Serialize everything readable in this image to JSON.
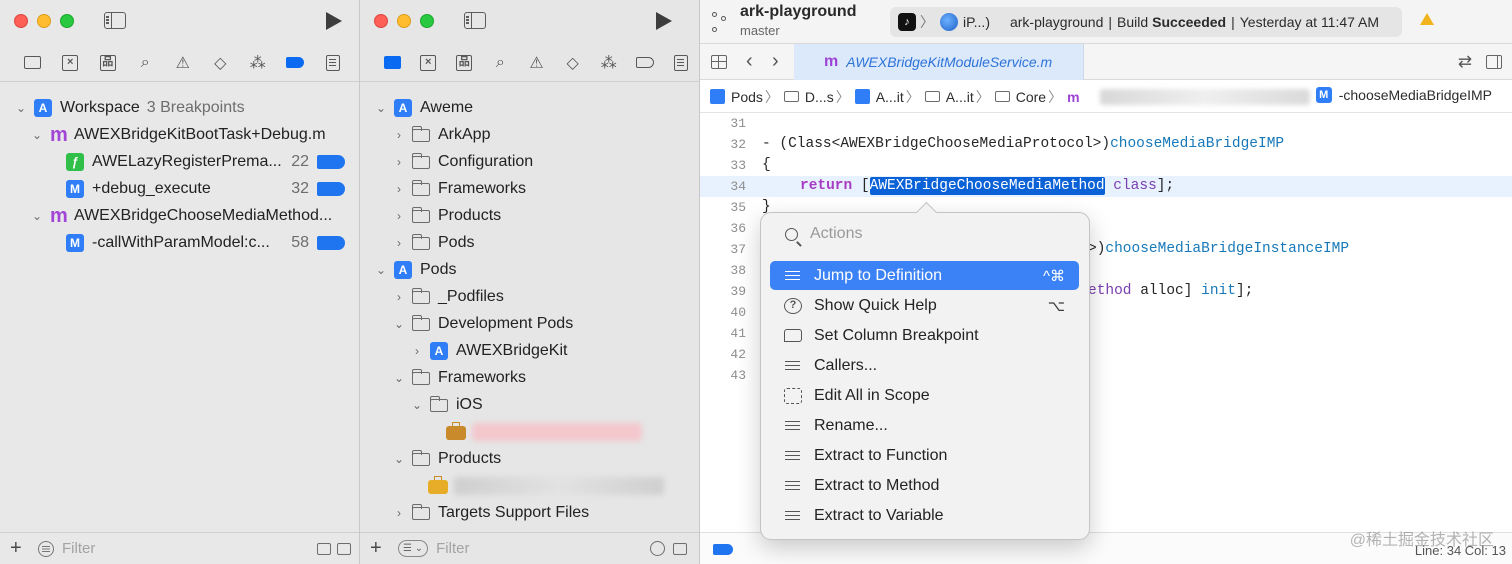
{
  "left_window": {
    "root": {
      "label": "Workspace",
      "sub": "3 Breakpoints"
    },
    "rows": [
      {
        "type": "mfile",
        "label": "AWEXBridgeKitBootTask+Debug.m"
      },
      {
        "type": "swift",
        "icon": "ƒ",
        "label": "AWELazyRegisterPrema...",
        "count": "22"
      },
      {
        "type": "method",
        "icon": "M",
        "label": "+debug_execute",
        "count": "32"
      },
      {
        "type": "mfile",
        "label": "AWEXBridgeChooseMediaMethod..."
      },
      {
        "type": "method",
        "icon": "M",
        "label": "-callWithParamModel:c...",
        "count": "58"
      }
    ],
    "filter_placeholder": "Filter",
    "add_label": "+"
  },
  "mid_window": {
    "rows": [
      {
        "label": "Aweme",
        "kind": "project",
        "icon": "A"
      },
      {
        "label": "ArkApp",
        "kind": "folder"
      },
      {
        "label": "Configuration",
        "kind": "folder"
      },
      {
        "label": "Frameworks",
        "kind": "folder"
      },
      {
        "label": "Products",
        "kind": "folder"
      },
      {
        "label": "Pods",
        "kind": "folder"
      },
      {
        "label": "Pods",
        "kind": "project",
        "icon": "A"
      },
      {
        "label": "_Podfiles",
        "kind": "folder"
      },
      {
        "label": "Development Pods",
        "kind": "folder"
      },
      {
        "label": "AWEXBridgeKit",
        "kind": "project",
        "icon": "A"
      },
      {
        "label": "Frameworks",
        "kind": "folder"
      },
      {
        "label": "iOS",
        "kind": "folder"
      },
      {
        "label": "Products",
        "kind": "folder"
      },
      {
        "label": "Targets Support Files",
        "kind": "folder"
      }
    ],
    "filter_placeholder": "Filter",
    "add_label": "+"
  },
  "editor": {
    "project_name": "ark-playground",
    "branch": "master",
    "status": {
      "app_icon": "♪",
      "device": "iP...)",
      "project": "ark-playground",
      "sep1": "|",
      "build_prefix": "Build",
      "build_state": "Succeeded",
      "sep2": "|",
      "time": "Yesterday at 11:47 AM"
    },
    "tab_icon": "m",
    "tab_file": "AWEXBridgeKitModuleService.m",
    "jumpbar": [
      "Pods",
      "D...s",
      "A...it",
      "A...it",
      "Core"
    ],
    "jumpbar_file_icon": "m",
    "jumpbar_method_icon": "M",
    "jumpbar_method": "-chooseMediaBridgeIMP",
    "lines": {
      "l31": "31",
      "l32": "32",
      "l33": "33",
      "l34": "34",
      "l35": "35",
      "l36": "36",
      "l37": "37",
      "l38": "38",
      "l39": "39",
      "l40": "40",
      "l41": "41",
      "l42": "42",
      "l43": "43"
    },
    "code": {
      "c32_a": "- (Class<AWEXBridgeChooseMediaProtocol>)",
      "c32_b": "chooseMediaBridgeIMP",
      "c33": "{",
      "c34_kw": "return",
      "c34_open": " [",
      "c34_sel": "AWEXBridgeChooseMediaMethod",
      "c34_cls": "class",
      "c34_end": "];",
      "c35": "}",
      "c37_a": ">)",
      "c37_b": "chooseMediaBridgeInstanceIMP",
      "c39_a": "ethod",
      "c39_b": " alloc] ",
      "c39_c": "init",
      "c39_d": "];"
    },
    "line_col": "Line: 34  Col: 13",
    "watermark": "@稀土掘金技术社区"
  },
  "context_menu": {
    "search_placeholder": "Actions",
    "items": [
      {
        "label": "Jump to Definition",
        "shortcut": "^⌘",
        "selected": true
      },
      {
        "label": "Show Quick Help",
        "shortcut": "⌥",
        "icon_glyph": "?"
      },
      {
        "label": "Set Column Breakpoint",
        "shortcut": ""
      },
      {
        "label": "Callers...",
        "shortcut": ""
      },
      {
        "label": "Edit All in Scope",
        "shortcut": ""
      },
      {
        "label": "Rename...",
        "shortcut": ""
      },
      {
        "label": "Extract to Function",
        "shortcut": ""
      },
      {
        "label": "Extract to Method",
        "shortcut": ""
      },
      {
        "label": "Extract to Variable",
        "shortcut": ""
      }
    ]
  },
  "colors": {
    "accent": "#0b6af2",
    "selection": "#3b82f6",
    "keyword": "#a83bc4",
    "function": "#1779b9",
    "breakpoint": "#1f74f0"
  }
}
